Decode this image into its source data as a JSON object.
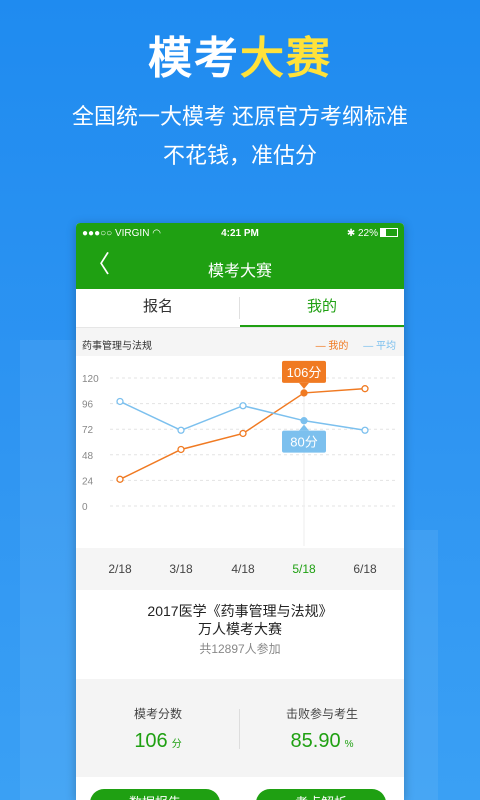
{
  "hero": {
    "title_part1": "模考",
    "title_part2": "大赛",
    "subtitle1": "全国统一大模考 还原官方考纲标准",
    "subtitle2": "不花钱，准估分"
  },
  "status_bar": {
    "carrier": "●●●○○ VIRGIN",
    "time": "4:21 PM",
    "battery": "22%"
  },
  "nav": {
    "back": "〈",
    "title": "模考大赛"
  },
  "tabs": [
    {
      "label": "报名"
    },
    {
      "label": "我的"
    }
  ],
  "chart_header": {
    "subject": "药事管理与法规",
    "legend_mine": "— 我的",
    "legend_avg": "— 平均"
  },
  "chart_data": {
    "type": "line",
    "categories": [
      "2/18",
      "3/18",
      "4/18",
      "5/18",
      "6/18"
    ],
    "series": [
      {
        "name": "我的",
        "values": [
          25,
          53,
          68,
          106,
          110
        ]
      },
      {
        "name": "平均",
        "values": [
          98,
          71,
          94,
          80,
          71
        ]
      }
    ],
    "y_ticks": [
      "120",
      "96",
      "72",
      "48",
      "24",
      "0"
    ],
    "ylim": [
      0,
      120
    ],
    "selected_index": 3,
    "callout_mine": "106分",
    "callout_avg": "80分",
    "colors": {
      "mine": "#f07a22",
      "avg": "#7cc0ee"
    }
  },
  "exam_info": {
    "line1": "2017医学《药事管理与法规》",
    "line2": "万人模考大赛",
    "participants": "共12897人参加"
  },
  "stats": {
    "score_label": "模考分数",
    "score_value": "106",
    "score_unit": "分",
    "beat_label": "击败参与考生",
    "beat_value": "85.90",
    "beat_unit": "%"
  },
  "buttons": {
    "report": "数据报告",
    "analysis": "考点解析"
  },
  "colors": {
    "brand_green": "#1fa012",
    "hero_blue": "#2a90f2",
    "highlight_yellow": "#ffe23a"
  }
}
